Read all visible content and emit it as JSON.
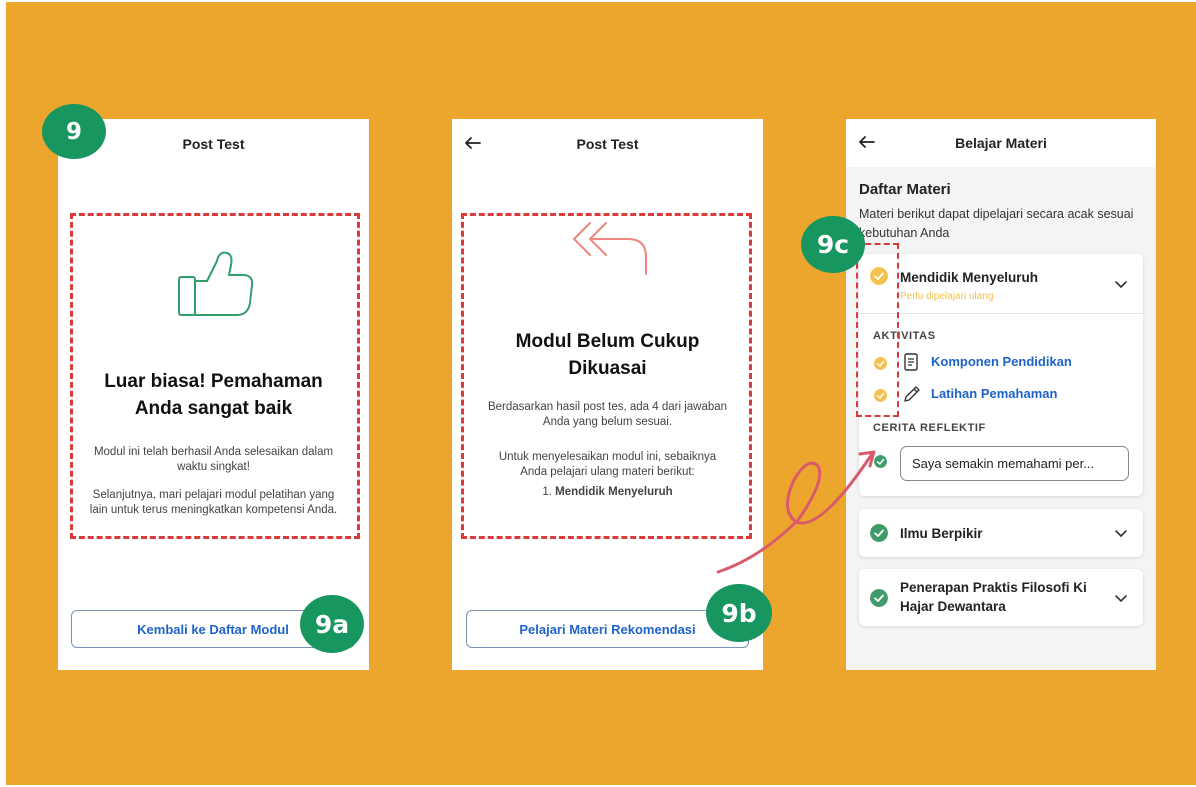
{
  "screen1": {
    "title": "Post Test",
    "badge": "9",
    "heading": "Luar biasa! Pemahaman Anda sangat baik",
    "paragraph1": "Modul ini telah berhasil Anda selesaikan dalam waktu singkat!",
    "paragraph2": "Selanjutnya, mari pelajari modul pelatihan yang lain untuk terus meningkatkan kompetensi Anda.",
    "button_label": "Kembali ke Daftar Modul",
    "button_badge": "9a",
    "icon": "thumbs-up-icon"
  },
  "screen2": {
    "title": "Post Test",
    "heading": "Modul Belum Cukup Dikuasai",
    "paragraph1": "Berdasarkan hasil post tes, ada 4 dari jawaban Anda yang belum sesuai.",
    "paragraph2": "Untuk menyelesaikan modul ini, sebaiknya Anda pelajari ulang materi berikut:",
    "list_number": "1.",
    "list_item": "Mendidik Menyeluruh",
    "button_label": "Pelajari Materi Rekomendasi",
    "button_badge": "9b",
    "icon": "reply-all-icon"
  },
  "screen3": {
    "title": "Belajar Materi",
    "section_title": "Daftar Materi",
    "section_subtitle": "Materi berikut dapat dipelajari secara acak sesuai kebutuhan Anda",
    "badge": "9c",
    "modules": [
      {
        "title": "Mendidik Menyeluruh",
        "status": "Perlu dipelajari ulang"
      },
      {
        "title": "Ilmu Berpikir"
      },
      {
        "title": "Penerapan Praktis Filosofi Ki Hajar Dewantara"
      }
    ],
    "activities_label": "AKTIVITAS",
    "activities": [
      "Komponen Pendidikan",
      "Latihan Pemahaman"
    ],
    "reflective_label": "CERITA REFLEKTIF",
    "reflective_value": "Saya semakin memahami per..."
  },
  "colors": {
    "background": "#eca62d",
    "badge_green": "#17965f",
    "dashed_red": "#d93b3b",
    "link_blue": "#1e63c9",
    "check_yellow": "#f2c14e",
    "check_green": "#3f9b6a",
    "annotation_pink": "#d95a6a"
  }
}
